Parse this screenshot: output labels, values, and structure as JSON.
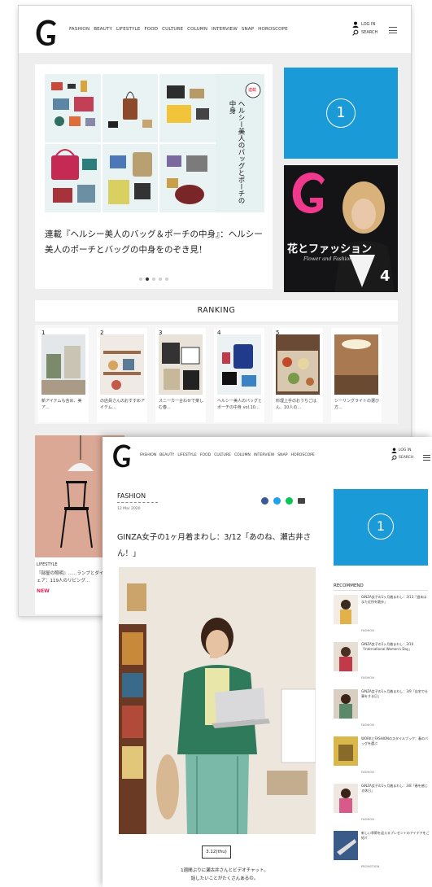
{
  "site": {
    "nav": [
      "FASHION",
      "BEAUTY",
      "LIFESTYLE",
      "FOOD",
      "CULTURE",
      "COLUMN",
      "INTERVIEW",
      "SNAP",
      "HOROSCOPE"
    ],
    "login_label": "LOG IN",
    "search_label": "SEARCH",
    "ad_label": "1"
  },
  "home": {
    "hero_caption": "連載『ヘルシー美人のバッグ＆ポーチの中身』：ヘルシー美人のポーチとバッグの中身をのぞき見！",
    "hero_vertical_title": "ヘルシー美人のバッグとポーチの中身",
    "hero_series_badge": "連載",
    "magazine_title": "花とファッション",
    "magazine_issue": "4",
    "magazine_sub": "Flower and Fashion",
    "ranking_title": "RANKING",
    "ranking": [
      {
        "num": "1",
        "text": "新アイテムも含め、美ア..."
      },
      {
        "num": "2",
        "text": "の店員さんのおすすめアイテム..."
      },
      {
        "num": "3",
        "text": "スニーカー合わせで楽しむ春..."
      },
      {
        "num": "4",
        "text": "ヘルシー美人のバッグとポーチの中身 vol.10..."
      },
      {
        "num": "5",
        "text": "料理上手のおうちごはん、10人の..."
      },
      {
        "num": "",
        "text": "シーリングライトの選び方..."
      }
    ],
    "bottom_tag": "LIFESTYLE",
    "bottom_caption": "『部屋の照明』……ランプとダイニングチェア：119人のリビング...",
    "bottom_new": "NEW"
  },
  "article": {
    "category": "FASHION",
    "date": "12 Mar 2020",
    "title": "GINZA女子の1ヶ月着まわし：3/12「あのね、瀬古井さん！」",
    "date_box": "3.12(thu)",
    "body_lines": [
      "1週間ぶりに瀬古井さんとビデオチャット。",
      "話したいことがたくさんあるの。"
    ],
    "recommend_title": "RECOMMEND",
    "recommend": [
      {
        "text": "GINZA女子の1ヶ月着まわし：3/13「週末はまた近所を散歩」",
        "tag": "FASHION"
      },
      {
        "text": "GINZA女子の1ヶ月着まわし：3/10「International Women's Day」",
        "tag": "FASHION"
      },
      {
        "text": "GINZA女子の1ヶ月着まわし：3/9「自宅で仕事をする日」",
        "tag": "FASHION"
      },
      {
        "text": "WORKとFASHIONのスタイルブック：春のバッグを選ぶ",
        "tag": "FASHION"
      },
      {
        "text": "GINZA女子の1ヶ月着まわし：3/8「春を感じる休日」",
        "tag": "FASHION"
      },
      {
        "text": "新しい季節を迎えるプレゼントのアイデアをご紹介",
        "tag": "PROMOTION"
      }
    ]
  }
}
